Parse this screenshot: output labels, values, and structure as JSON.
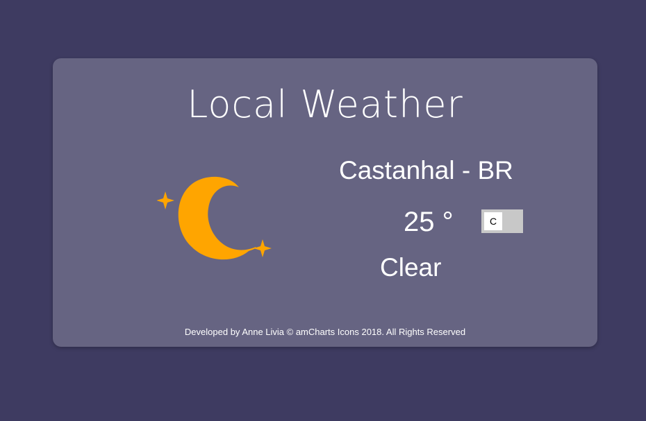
{
  "app": {
    "title": "Local Weather"
  },
  "weather": {
    "location": "Castanhal - BR",
    "temperature": "25 °",
    "unit_toggle_label": "C",
    "condition": "Clear",
    "icon": "moon-stars-icon",
    "icon_color": "#ffa500"
  },
  "footer": {
    "credit": "Developed by Anne Livia © amCharts Icons 2018. All Rights Reserved"
  },
  "colors": {
    "page_background": "#3e3b61",
    "card_background": "#666482",
    "text": "#ffffff",
    "toggle_track": "#c8c8c8"
  }
}
